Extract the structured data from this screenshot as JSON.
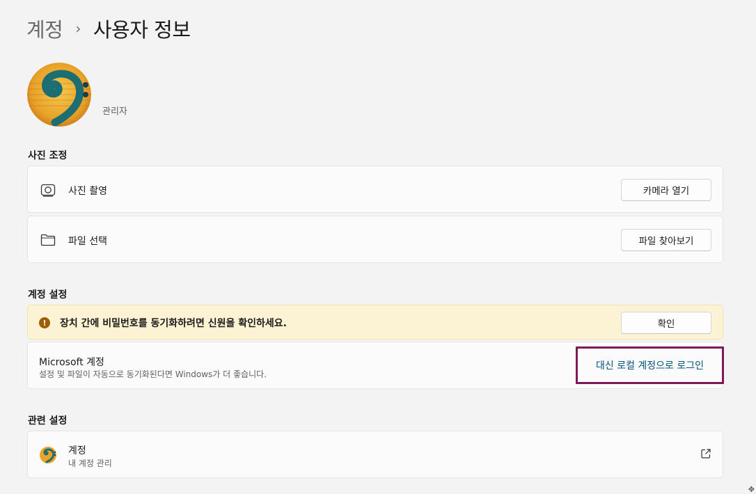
{
  "breadcrumb": {
    "parent": "계정",
    "separator": "›",
    "current": "사용자 정보"
  },
  "profile": {
    "role": "관리자"
  },
  "photo_section": {
    "title": "사진 조정",
    "items": [
      {
        "label": "사진 촬영",
        "icon": "camera-icon",
        "button": "카메라 열기"
      },
      {
        "label": "파일 선택",
        "icon": "folder-icon",
        "button": "파일 찾아보기"
      }
    ]
  },
  "account_section": {
    "title": "계정 설정",
    "warning": {
      "icon": "warning-icon",
      "text": "장치 간에 비밀번호를 동기화하려면 신원을 확인하세요.",
      "button": "확인"
    },
    "microsoft": {
      "title": "Microsoft 계정",
      "description": "설정 및 파일이 자동으로 동기화된다면 Windows가 더 좋습니다.",
      "link": "대신 로컬 계정으로 로그인"
    }
  },
  "related_section": {
    "title": "관련 설정",
    "item": {
      "title": "계정",
      "subtitle": "내 계정 관리",
      "icon": "external-link-icon"
    }
  },
  "colors": {
    "background": "#f3f3f3",
    "card": "#fbfbfb",
    "warning_bg": "#fcf3d5",
    "warning_icon": "#9d5d00",
    "link": "#00557a",
    "highlight_border": "#7b1a57"
  }
}
